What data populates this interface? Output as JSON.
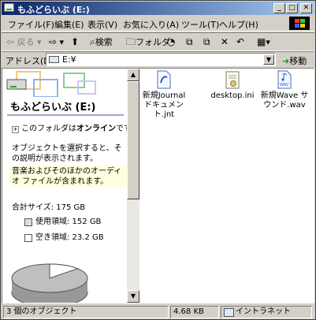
{
  "window": {
    "title": "もふどらいぶ (E:)"
  },
  "menu": [
    "ファイル(F)",
    "編集(E)",
    "表示(V)",
    "お気に入り(A)",
    "ツール(T)",
    "ヘルプ(H)"
  ],
  "toolbar": {
    "back": "戻る",
    "search": "検索",
    "folders": "フォルダ"
  },
  "address": {
    "label": "アドレス(D)",
    "value": "E:¥",
    "go": "移動"
  },
  "left_pane": {
    "drive_title": "もふどらいぶ (E:)",
    "online_pre": "このフォルダは",
    "online_bold": "オンライン",
    "online_post": "です。",
    "select_hint": "オブジェクトを選択すると、その説明が表示されます。",
    "media_info": "音楽およびそのほかのオーディオ ファイルが含まれます。",
    "total_size": "合計サイズ: 175 GB",
    "used": "使用領域: 152 GB",
    "free": "空き領域: 23.2 GB",
    "used_fraction": 0.868
  },
  "files": [
    {
      "name": "新規Journal ドキュメント.jnt",
      "icon": "journal-document-icon"
    },
    {
      "name": "desktop.ini",
      "icon": "settings-file-icon"
    },
    {
      "name": "新規Wave サウンド.wav",
      "icon": "wave-sound-icon"
    }
  ],
  "status": {
    "objects": "3 個のオブジェクト",
    "size": "4.68 KB",
    "zone": "イントラネット"
  },
  "colors": {
    "used": "#7f7fff",
    "free": "#ff7fff"
  }
}
